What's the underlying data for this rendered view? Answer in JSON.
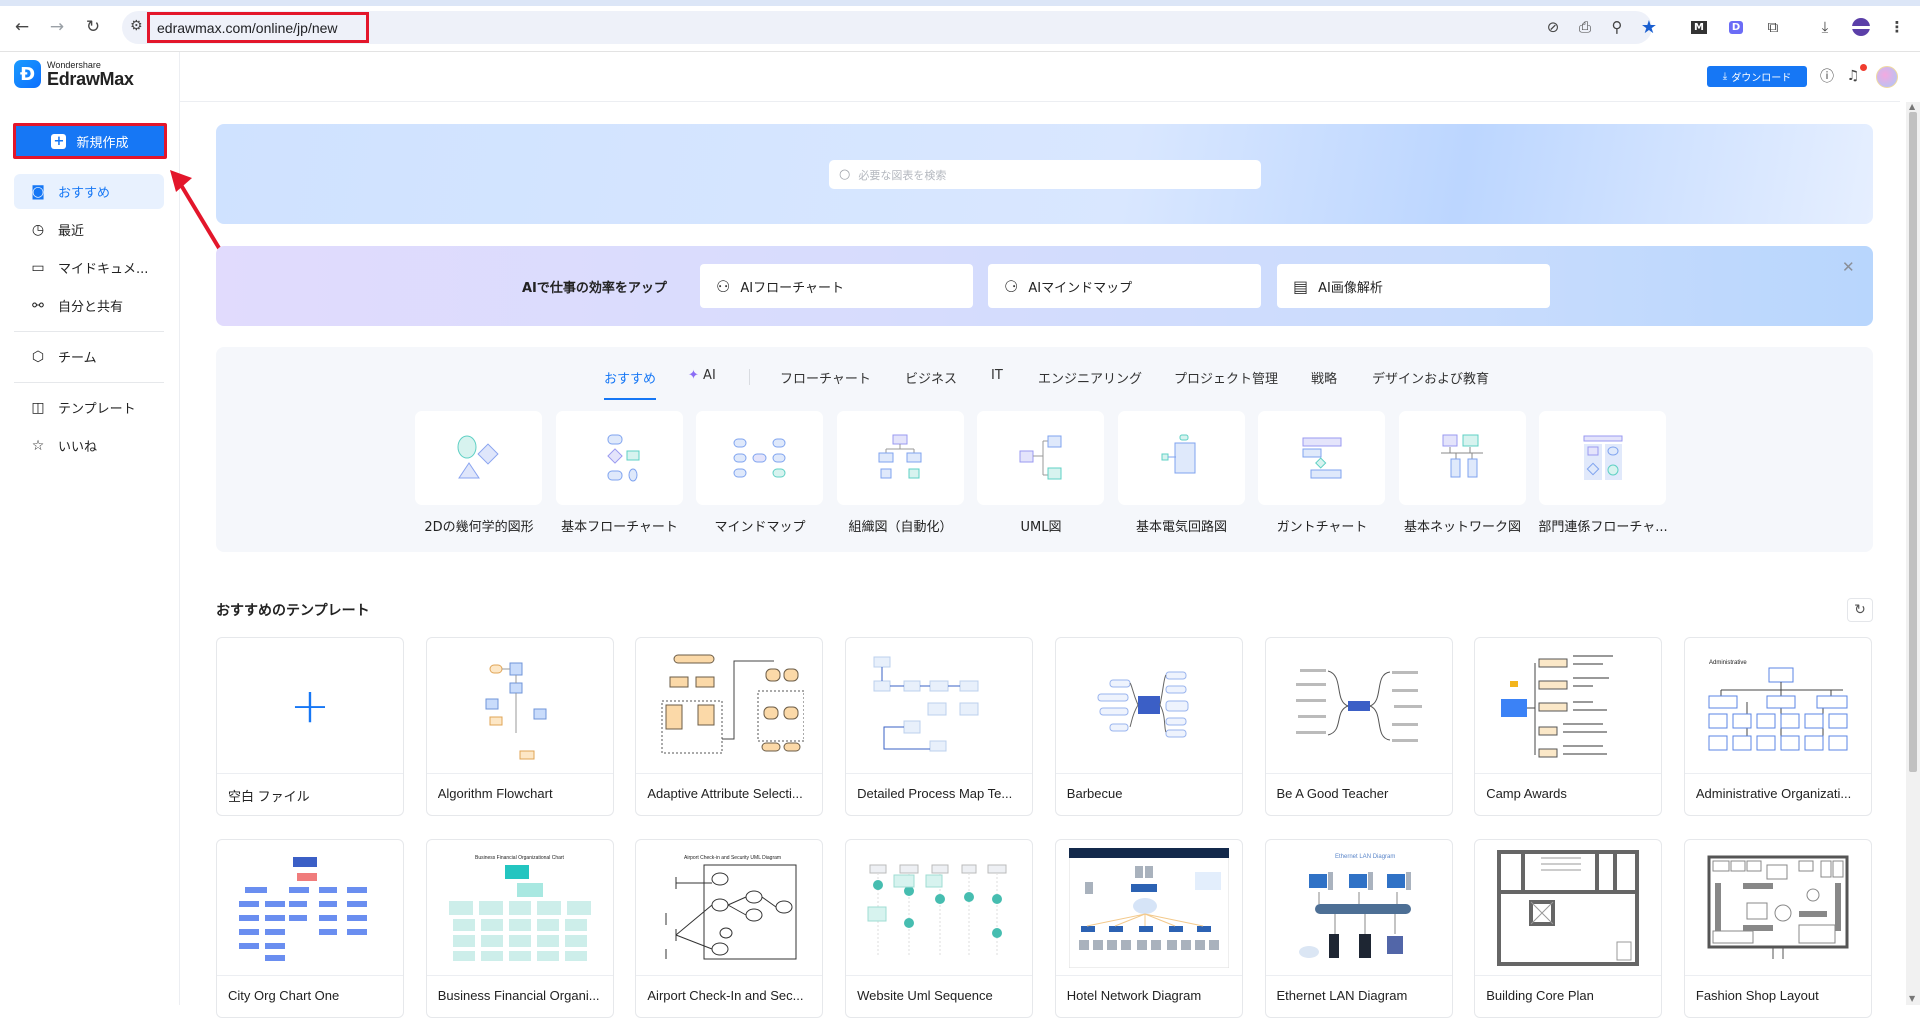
{
  "browser": {
    "url": "edrawmax.com/online/jp/new",
    "back_icon": "←",
    "forward_icon": "→",
    "reload_icon": "↻",
    "toolbar_icons": [
      "camera-off-icon",
      "install-app-icon",
      "zoom-out-icon",
      "bookmark-star-icon",
      "extension-m-icon",
      "extension-d-icon",
      "extensions-puzzle-icon",
      "download-icon",
      "profile-icon",
      "menu-kebab-icon"
    ]
  },
  "app": {
    "brand_small": "Wondershare",
    "brand_big": "EdrawMax",
    "download_label": "ダウンロード"
  },
  "sidebar": {
    "new_button": "新規作成",
    "items": [
      {
        "label": "おすすめ",
        "icon": "recommend-icon",
        "active": true
      },
      {
        "label": "最近",
        "icon": "clock-icon"
      },
      {
        "label": "マイドキュメ...",
        "icon": "folder-icon"
      },
      {
        "label": "自分と共有",
        "icon": "share-icon"
      },
      {
        "label": "チーム",
        "icon": "team-icon"
      },
      {
        "label": "テンプレート",
        "icon": "template-icon"
      },
      {
        "label": "いいね",
        "icon": "star-icon"
      }
    ]
  },
  "search": {
    "placeholder": "必要な図表を検索"
  },
  "ai_banner": {
    "title": "AIで仕事の効率をアップ",
    "cards": [
      {
        "label": "AIフローチャート",
        "icon": "ai-flowchart-icon"
      },
      {
        "label": "AIマインドマップ",
        "icon": "ai-mindmap-icon"
      },
      {
        "label": "AI画像解析",
        "icon": "ai-image-analysis-icon"
      }
    ]
  },
  "category_tabs": [
    {
      "label": "おすすめ",
      "active": true
    },
    {
      "label": "AI"
    },
    {
      "label": "フローチャート"
    },
    {
      "label": "ビジネス"
    },
    {
      "label": "IT"
    },
    {
      "label": "エンジニアリング"
    },
    {
      "label": "プロジェクト管理"
    },
    {
      "label": "戦略"
    },
    {
      "label": "デザインおよび教育"
    }
  ],
  "categories": [
    {
      "label": "2Dの幾何学的図形"
    },
    {
      "label": "基本フローチャート"
    },
    {
      "label": "マインドマップ"
    },
    {
      "label": "組織図（自動化）"
    },
    {
      "label": "UML図"
    },
    {
      "label": "基本電気回路図"
    },
    {
      "label": "ガントチャート"
    },
    {
      "label": "基本ネットワーク図"
    },
    {
      "label": "部門連係フローチャ..."
    }
  ],
  "templates": {
    "title": "おすすめのテンプレート",
    "items": [
      {
        "name": "空白 ファイル"
      },
      {
        "name": "Algorithm Flowchart"
      },
      {
        "name": "Adaptive Attribute Selecti..."
      },
      {
        "name": "Detailed Process Map Te..."
      },
      {
        "name": "Barbecue"
      },
      {
        "name": "Be A Good Teacher"
      },
      {
        "name": "Camp Awards"
      },
      {
        "name": "Administrative Organizati..."
      },
      {
        "name": "City Org Chart One"
      },
      {
        "name": "Business Financial Organi..."
      },
      {
        "name": "Airport Check-In and Sec..."
      },
      {
        "name": "Website Uml Sequence"
      },
      {
        "name": "Hotel Network Diagram"
      },
      {
        "name": "Ethernet LAN Diagram"
      },
      {
        "name": "Building Core Plan"
      },
      {
        "name": "Fashion Shop Layout"
      }
    ]
  },
  "colors": {
    "accent": "#1677f5",
    "highlight_border": "#e3162b"
  }
}
